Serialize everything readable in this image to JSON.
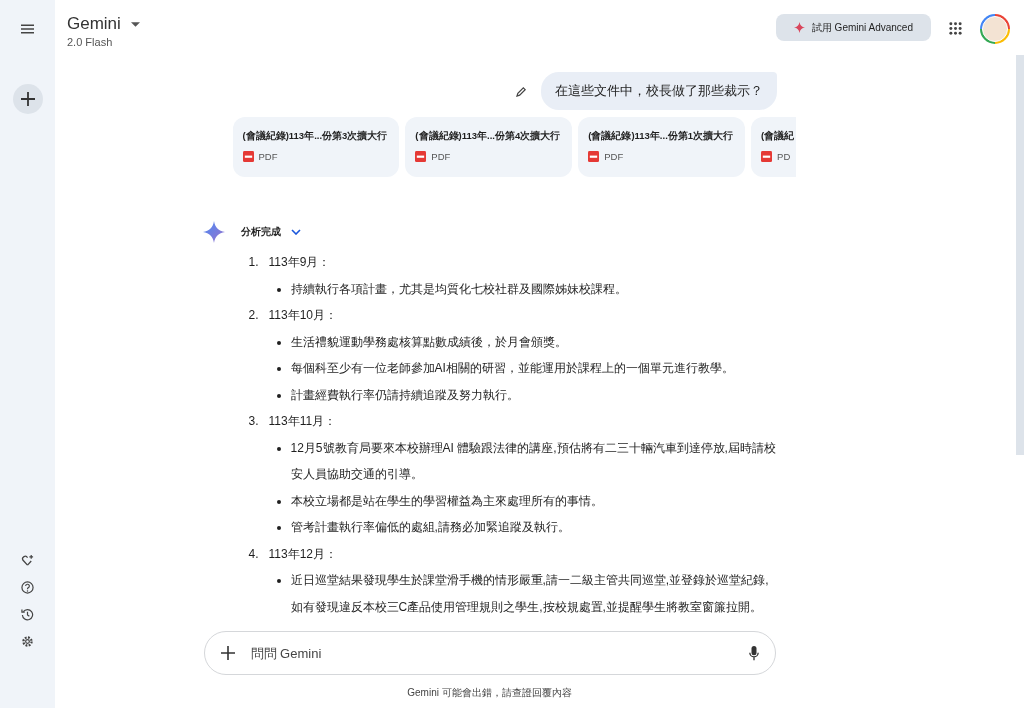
{
  "header": {
    "title": "Gemini",
    "model": "2.0 Flash",
    "upgrade_button": "試用 Gemini Advanced"
  },
  "user_message": {
    "text": "在這些文件中，校長做了那些裁示？"
  },
  "attachments": [
    {
      "title": "(會議紀錄)113年...份第3次擴大行",
      "type": "PDF"
    },
    {
      "title": "(會議紀錄)113年...份第4次擴大行",
      "type": "PDF"
    },
    {
      "title": "(會議紀錄)113年...份第1次擴大行",
      "type": "PDF"
    },
    {
      "title": "(會議紀",
      "type": "PD"
    }
  ],
  "response": {
    "status": "分析完成",
    "sections": [
      {
        "number": "1.",
        "heading": "113年9月：",
        "bullets": [
          "持續執行各項計畫，尤其是均質化七校社群及國際姊妹校課程。"
        ]
      },
      {
        "number": "2.",
        "heading": "113年10月：",
        "bullets": [
          "生活禮貌運動學務處核算點數成績後，於月會頒獎。",
          "每個科至少有一位老師參加AI相關的研習，並能運用於課程上的一個單元進行教學。",
          "計畫經費執行率仍請持續追蹤及努力執行。"
        ]
      },
      {
        "number": "3.",
        "heading": "113年11月：",
        "bullets": [
          "12月5號教育局要來本校辦理AI 體驗跟法律的講座,預估將有二三十輛汽車到達停放,屆時請校安人員協助交通的引導。",
          "本校立場都是站在學生的學習權益為主來處理所有的事情。",
          "管考計畫執行率偏低的處組,請務必加緊追蹤及執行。"
        ]
      },
      {
        "number": "4.",
        "heading": "113年12月：",
        "bullets": [
          "近日巡堂結果發現學生於課堂滑手機的情形嚴重,請一二級主管共同巡堂,並登錄於巡堂紀錄,如有發現違反本校三C產品使用管理規則之學生,按校規處置,並提醒學生將教室窗簾拉開。"
        ]
      }
    ]
  },
  "input": {
    "placeholder": "問問 Gemini"
  },
  "disclaimer": "Gemini 可能會出錯，請查證回覆內容"
}
